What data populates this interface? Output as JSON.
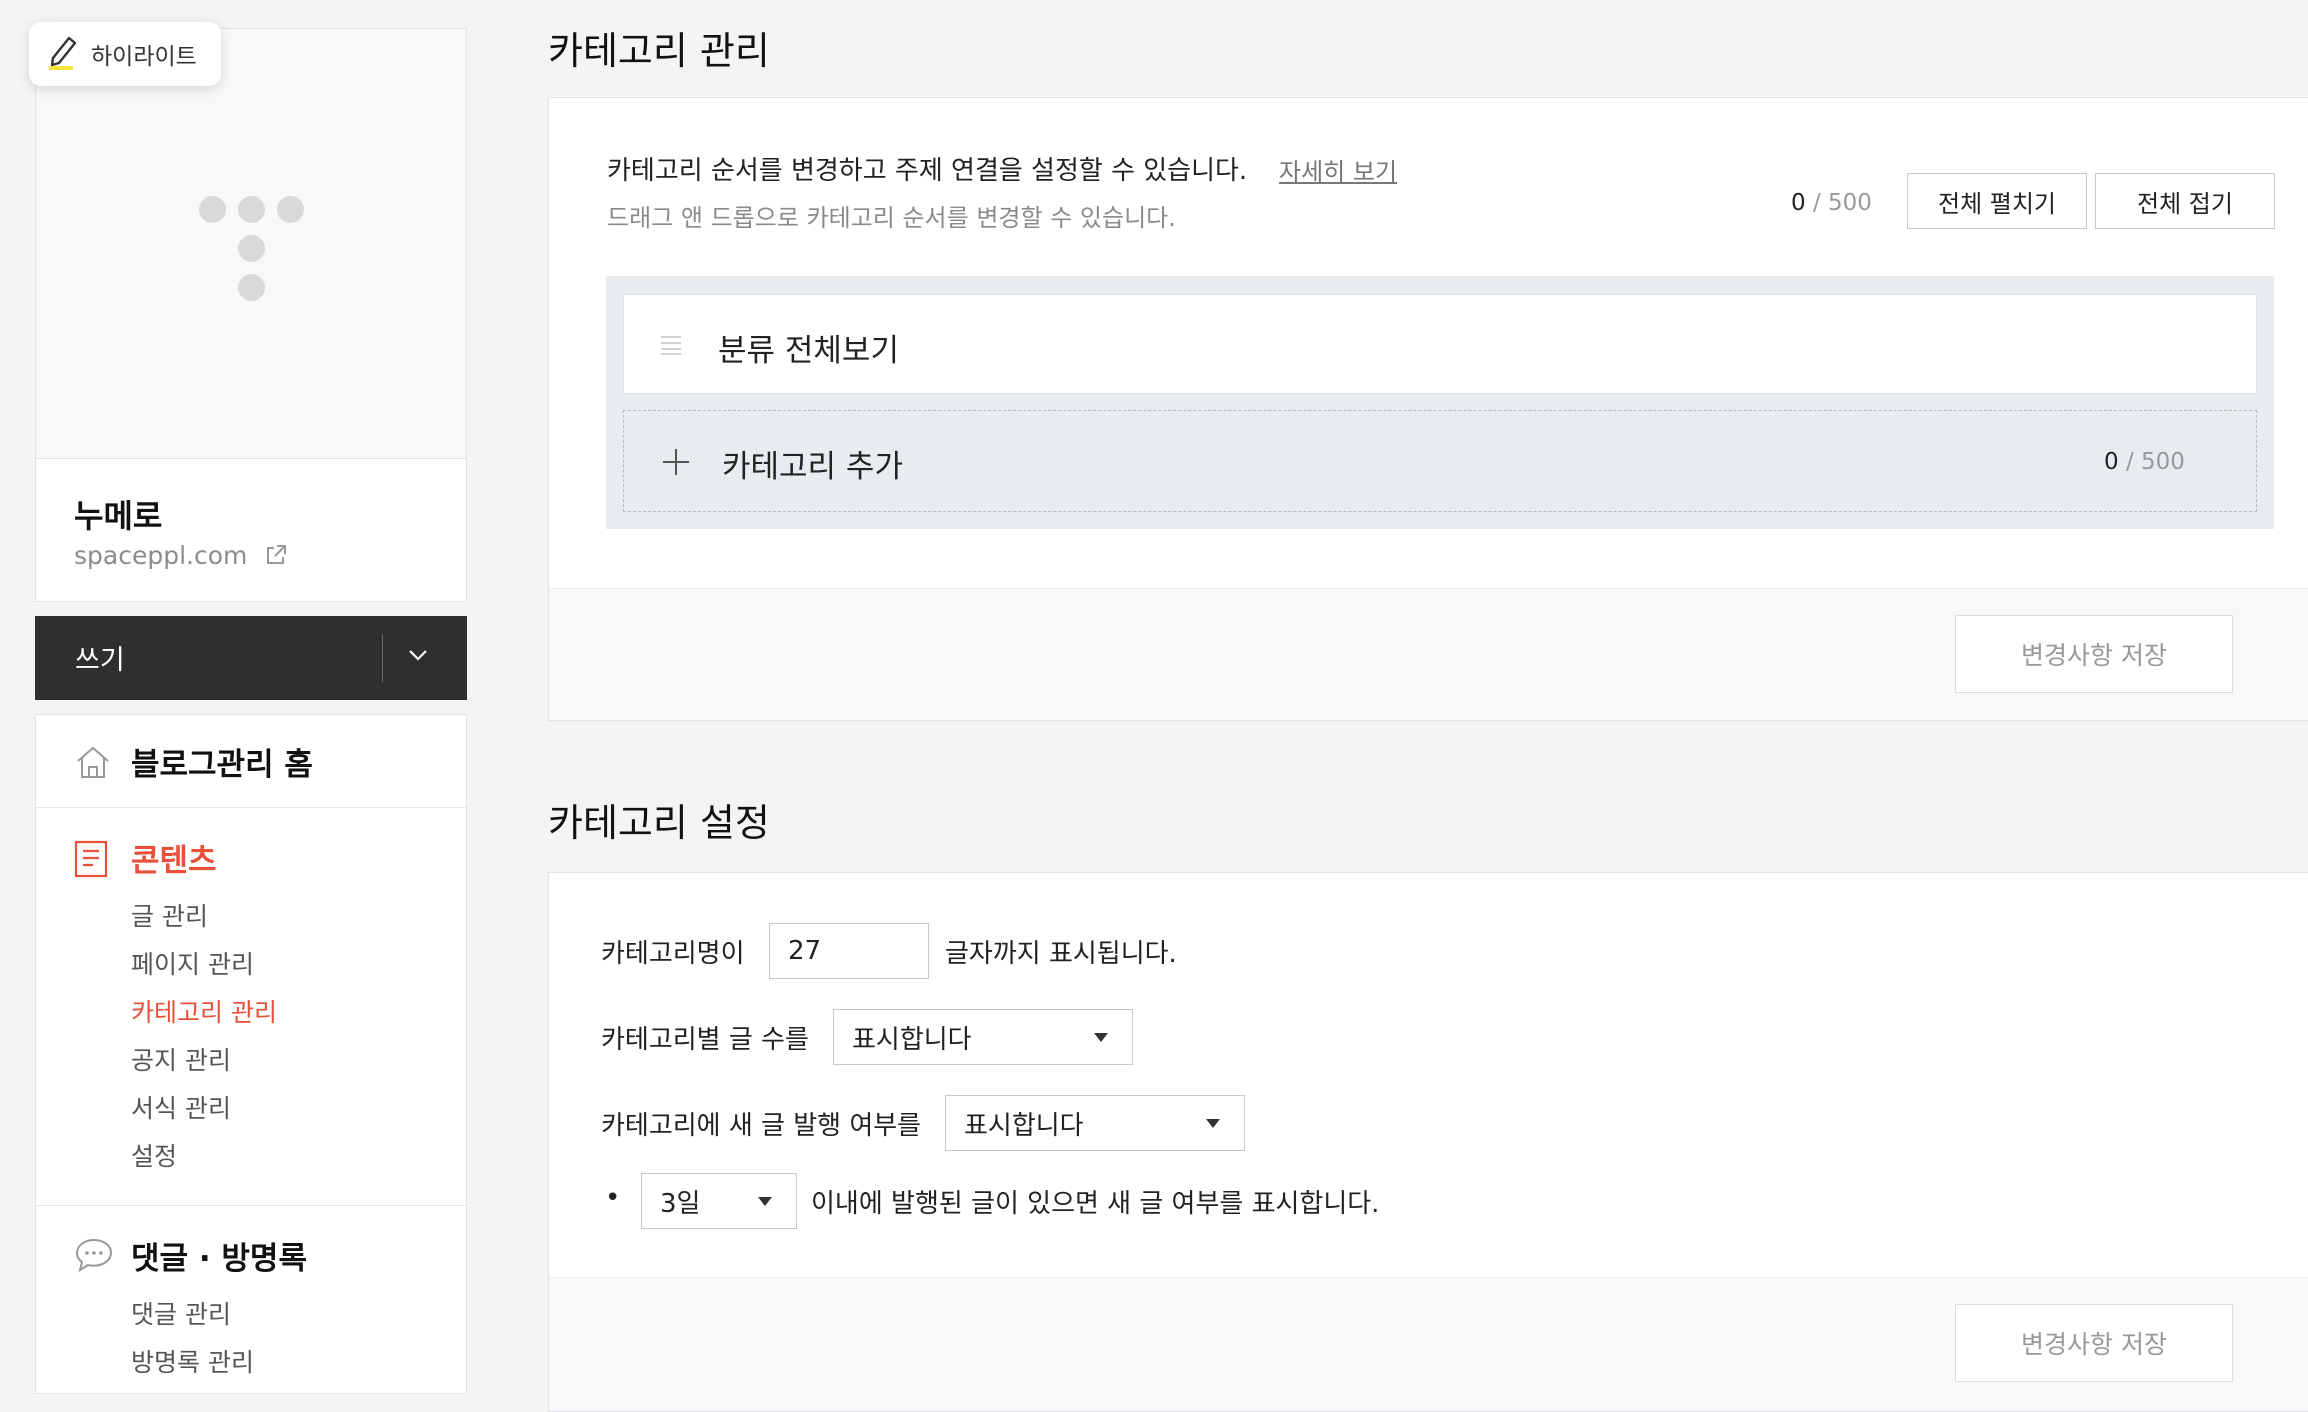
{
  "highlight_badge": {
    "label": "하이라이트"
  },
  "profile": {
    "blog_name": "누메로",
    "blog_url": "spaceppl.com"
  },
  "write_button": {
    "label": "쓰기"
  },
  "sidebar": {
    "home": {
      "label": "블로그관리 홈"
    },
    "content": {
      "title": "콘텐츠",
      "items": [
        {
          "label": "글 관리"
        },
        {
          "label": "페이지 관리"
        },
        {
          "label": "카테고리 관리",
          "active": true
        },
        {
          "label": "공지 관리"
        },
        {
          "label": "서식 관리"
        },
        {
          "label": "설정"
        }
      ]
    },
    "comments": {
      "title": "댓글 · 방명록",
      "items": [
        {
          "label": "댓글 관리"
        },
        {
          "label": "방명록 관리"
        }
      ]
    }
  },
  "category_manage": {
    "title": "카테고리 관리",
    "description": "카테고리 순서를 변경하고 주제 연결을 설정할 수 있습니다.",
    "detail_link": "자세히 보기",
    "hint": "드래그 앤 드롭으로 카테고리 순서를 변경할 수 있습니다.",
    "count": "0",
    "count_max": "/ 500",
    "expand_all": "전체 펼치기",
    "collapse_all": "전체 접기",
    "view_all_row": "분류 전체보기",
    "add_row": "카테고리 추가",
    "add_count": "0",
    "add_count_max": "/ 500",
    "save": "변경사항 저장"
  },
  "category_settings": {
    "title": "카테고리 설정",
    "name_prefix": "카테고리명이",
    "name_length": "27",
    "name_suffix": "글자까지 표시됩니다.",
    "post_count_label": "카테고리별 글 수를",
    "post_count_value": "표시합니다",
    "new_post_label": "카테고리에 새 글 발행 여부를",
    "new_post_value": "표시합니다",
    "bullet": "•",
    "days_value": "3일",
    "days_suffix": "이내에 발행된 글이 있으면 새 글 여부를 표시합니다.",
    "save": "변경사항 저장"
  }
}
